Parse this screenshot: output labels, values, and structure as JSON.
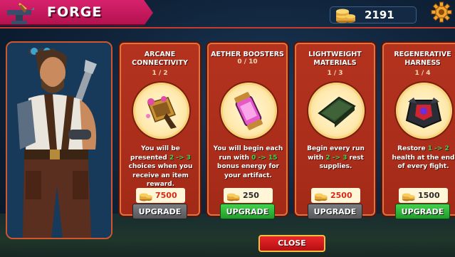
{
  "header": {
    "title": "FORGE",
    "icon": "anvil-icon"
  },
  "currency": {
    "value": "2191",
    "icon": "coin-stack-icon"
  },
  "settings": {
    "icon": "gear-icon"
  },
  "cards": [
    {
      "title": "ARCANE\nCONNECTIVITY",
      "level": "1 / 2",
      "desc_parts": [
        "You will be presented ",
        "2 -> 3",
        " choices when you receive an item reward."
      ],
      "price": "7500",
      "price_color": "#d42a1a",
      "button": "UPGRADE",
      "button_state": "disabled",
      "icon": "golden-artifact-icon"
    },
    {
      "title": "AETHER BOOSTERS",
      "level": "0 / 10",
      "desc_parts": [
        "You will begin each run with ",
        "0 -> 15",
        " bonus energy for your artifact."
      ],
      "price": "250",
      "price_color": "#2b2b2b",
      "button": "UPGRADE",
      "button_state": "enabled",
      "icon": "energy-canister-icon"
    },
    {
      "title": "LIGHTWEIGHT\nMATERIALS",
      "level": "1 / 3",
      "desc_parts": [
        "Begin every run with ",
        "2 -> 3",
        " rest supplies."
      ],
      "price": "2500",
      "price_color": "#d42a1a",
      "button": "UPGRADE",
      "button_state": "disabled",
      "icon": "bedroll-icon"
    },
    {
      "title": "REGENERATIVE\nHARNESS",
      "level": "1 / 4",
      "desc_parts": [
        "Restore ",
        "1 -> 2",
        " health at the end of every fight."
      ],
      "price": "1500",
      "price_color": "#2b2b2b",
      "button": "UPGRADE",
      "button_state": "enabled",
      "icon": "harness-icon"
    }
  ],
  "close_label": "CLOSE",
  "colors": {
    "accent": "#d7216d",
    "card": "#b4331f",
    "highlight": "#38d455"
  }
}
